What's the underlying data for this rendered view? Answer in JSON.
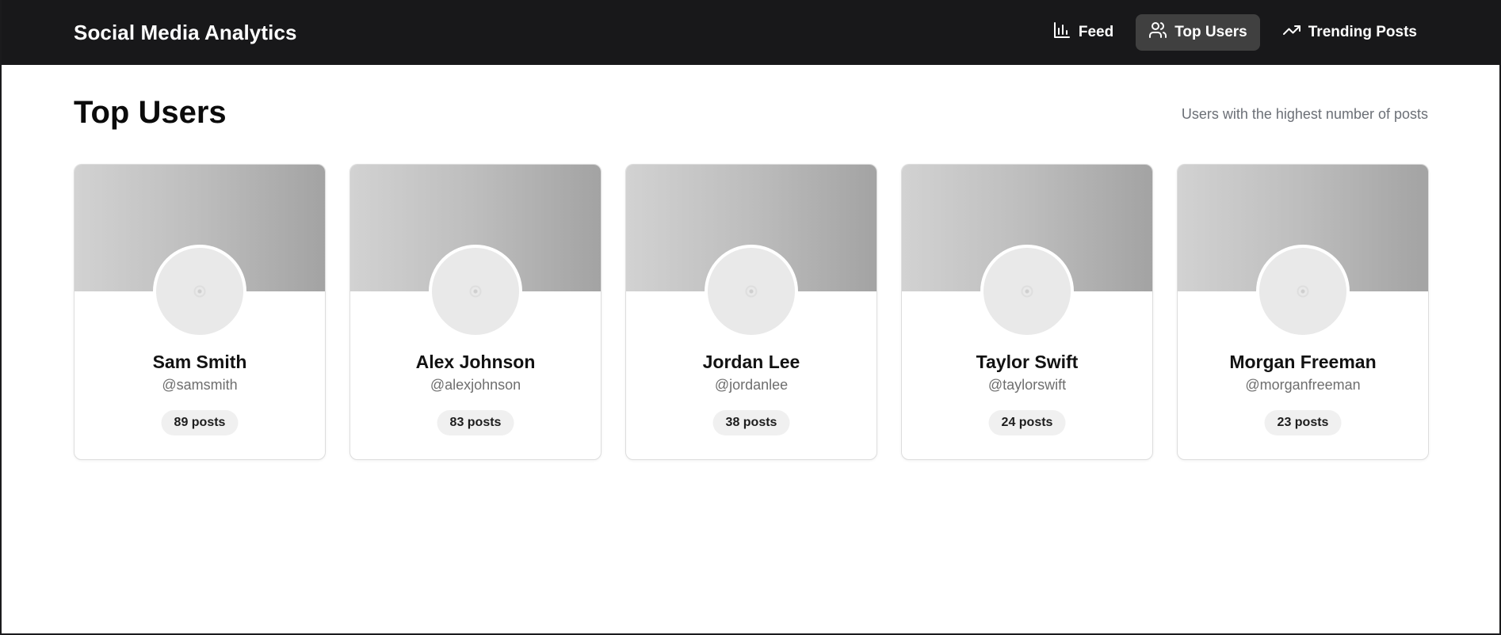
{
  "app": {
    "title": "Social Media Analytics"
  },
  "nav": {
    "items": [
      {
        "label": "Feed",
        "icon": "bar-chart-icon",
        "active": false
      },
      {
        "label": "Top Users",
        "icon": "users-icon",
        "active": true
      },
      {
        "label": "Trending Posts",
        "icon": "trending-up-icon",
        "active": false
      }
    ]
  },
  "page": {
    "title": "Top Users",
    "subtitle": "Users with the highest number of posts"
  },
  "users": [
    {
      "name": "Sam Smith",
      "handle": "@samsmith",
      "posts": "89 posts"
    },
    {
      "name": "Alex Johnson",
      "handle": "@alexjohnson",
      "posts": "83 posts"
    },
    {
      "name": "Jordan Lee",
      "handle": "@jordanlee",
      "posts": "38 posts"
    },
    {
      "name": "Taylor Swift",
      "handle": "@taylorswift",
      "posts": "24 posts"
    },
    {
      "name": "Morgan Freeman",
      "handle": "@morganfreeman",
      "posts": "23 posts"
    }
  ],
  "colors": {
    "navbar_bg": "#18181a",
    "active_tab_bg": "#404040",
    "subtitle_text": "#6b6f76",
    "banner_gradient": [
      "#d2d2d2",
      "#a3a3a3"
    ]
  }
}
